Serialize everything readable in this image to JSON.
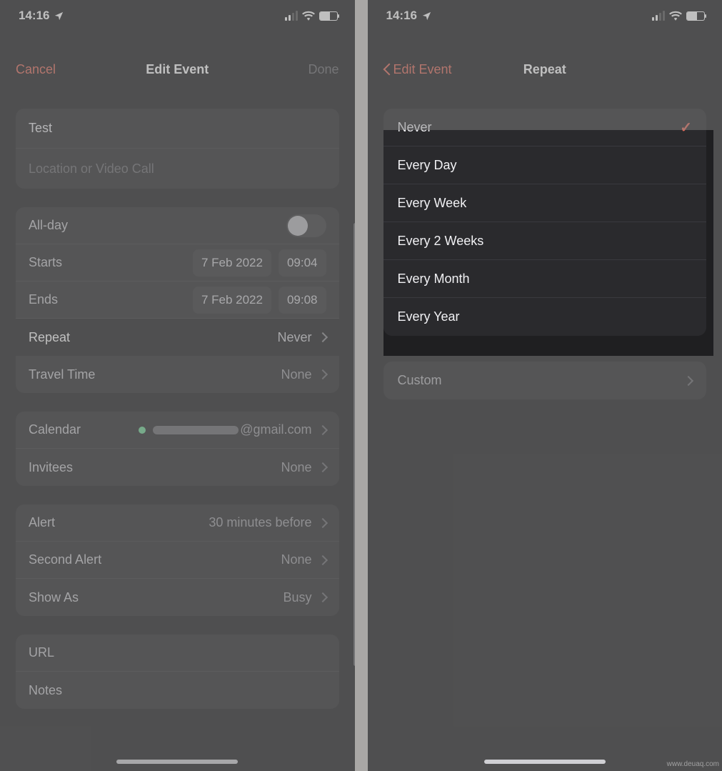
{
  "status": {
    "time": "14:16"
  },
  "left": {
    "nav": {
      "cancel": "Cancel",
      "title": "Edit Event",
      "done": "Done"
    },
    "event": {
      "title": "Test",
      "locationPlaceholder": "Location or Video Call"
    },
    "allDay": {
      "label": "All-day"
    },
    "starts": {
      "label": "Starts",
      "date": "7 Feb 2022",
      "time": "09:04"
    },
    "ends": {
      "label": "Ends",
      "date": "7 Feb 2022",
      "time": "09:08"
    },
    "repeat": {
      "label": "Repeat",
      "value": "Never"
    },
    "travel": {
      "label": "Travel Time",
      "value": "None"
    },
    "calendar": {
      "label": "Calendar",
      "value": "@gmail.com"
    },
    "invitees": {
      "label": "Invitees",
      "value": "None"
    },
    "alert": {
      "label": "Alert",
      "value": "30 minutes before"
    },
    "alert2": {
      "label": "Second Alert",
      "value": "None"
    },
    "showAs": {
      "label": "Show As",
      "value": "Busy"
    },
    "url": {
      "label": "URL"
    },
    "notes": {
      "label": "Notes"
    }
  },
  "right": {
    "nav": {
      "back": "Edit Event",
      "title": "Repeat"
    },
    "options": [
      {
        "label": "Never",
        "selected": true
      },
      {
        "label": "Every Day",
        "selected": false
      },
      {
        "label": "Every Week",
        "selected": false
      },
      {
        "label": "Every 2 Weeks",
        "selected": false
      },
      {
        "label": "Every Month",
        "selected": false
      },
      {
        "label": "Every Year",
        "selected": false
      }
    ],
    "custom": {
      "label": "Custom"
    }
  },
  "watermark": "www.deuaq.com"
}
